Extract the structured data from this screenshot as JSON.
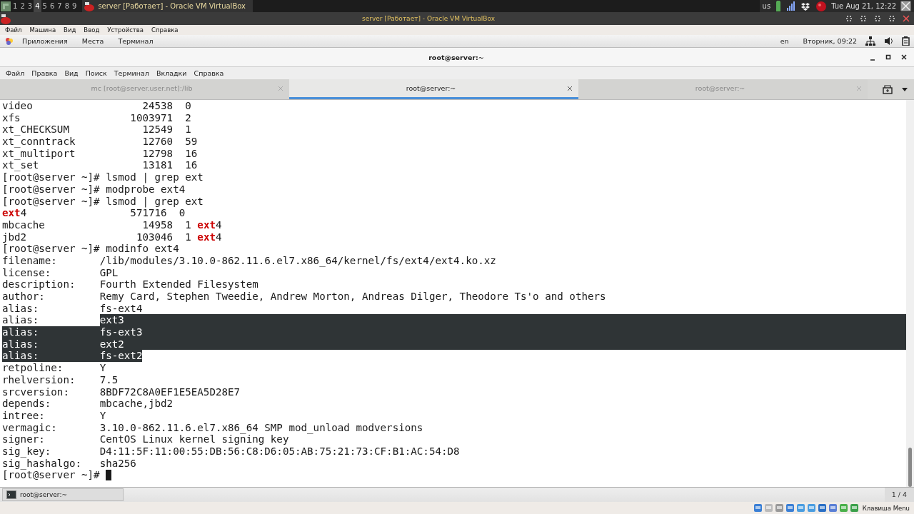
{
  "top_bar": {
    "workspaces": [
      {
        "label": "1",
        "selected": false
      },
      {
        "label": "2",
        "selected": false
      },
      {
        "label": "3",
        "selected": false
      },
      {
        "label": "4",
        "selected": true
      },
      {
        "label": "5",
        "selected": false
      },
      {
        "label": "6",
        "selected": false
      },
      {
        "label": "7",
        "selected": false
      },
      {
        "label": "8",
        "selected": false
      },
      {
        "label": "9",
        "selected": false
      }
    ],
    "task": "server [Работает] - Oracle VM VirtualBox",
    "layout": "us",
    "clock": "Tue Aug 21, 12:22"
  },
  "vm_window": {
    "title": "server [Работает] - Oracle VM VirtualBox",
    "menu": [
      "Файл",
      "Машина",
      "Вид",
      "Ввод",
      "Устройства",
      "Справка"
    ]
  },
  "gnome_panel": {
    "items": [
      "Приложения",
      "Места",
      "Терминал"
    ],
    "language": "en",
    "clock": "Вторник, 09:22"
  },
  "terminal": {
    "title": "root@server:~",
    "menu": [
      "Файл",
      "Правка",
      "Вид",
      "Поиск",
      "Терминал",
      "Вкладки",
      "Справка"
    ],
    "tabs": [
      {
        "label": "mc [root@server.user.net]:/lib",
        "selected": false
      },
      {
        "label": "root@server:~",
        "selected": true
      },
      {
        "label": "root@server:~",
        "selected": false
      }
    ],
    "lines": [
      {
        "segments": [
          {
            "kind": "text",
            "text": "video                  24538  0"
          }
        ]
      },
      {
        "segments": [
          {
            "kind": "text",
            "text": "xfs                  1003971  2"
          }
        ]
      },
      {
        "segments": [
          {
            "kind": "text",
            "text": "xt_CHECKSUM            12549  1"
          }
        ]
      },
      {
        "segments": [
          {
            "kind": "text",
            "text": "xt_conntrack           12760  59"
          }
        ]
      },
      {
        "segments": [
          {
            "kind": "text",
            "text": "xt_multiport           12798  16"
          }
        ]
      },
      {
        "segments": [
          {
            "kind": "text",
            "text": "xt_set                 13181  16"
          }
        ]
      },
      {
        "segments": [
          {
            "kind": "text",
            "text": "[root@server ~]# lsmod | grep ext"
          }
        ]
      },
      {
        "segments": [
          {
            "kind": "text",
            "text": "[root@server ~]# modprobe ext4"
          }
        ]
      },
      {
        "segments": [
          {
            "kind": "text",
            "text": "[root@server ~]# lsmod | grep ext"
          }
        ]
      },
      {
        "segments": [
          {
            "kind": "match",
            "text": "ext"
          },
          {
            "kind": "text",
            "text": "4                 571716  0"
          }
        ]
      },
      {
        "segments": [
          {
            "kind": "text",
            "text": "mbcache                14958  1 "
          },
          {
            "kind": "match",
            "text": "ext"
          },
          {
            "kind": "text",
            "text": "4"
          }
        ]
      },
      {
        "segments": [
          {
            "kind": "text",
            "text": "jbd2                  103046  1 "
          },
          {
            "kind": "match",
            "text": "ext"
          },
          {
            "kind": "text",
            "text": "4"
          }
        ]
      },
      {
        "segments": [
          {
            "kind": "text",
            "text": "[root@server ~]# modinfo ext4"
          }
        ]
      },
      {
        "segments": [
          {
            "kind": "text",
            "text": "filename:       /lib/modules/3.10.0-862.11.6.el7.x86_64/kernel/fs/ext4/ext4.ko.xz"
          }
        ]
      },
      {
        "segments": [
          {
            "kind": "text",
            "text": "license:        GPL"
          }
        ]
      },
      {
        "segments": [
          {
            "kind": "text",
            "text": "description:    Fourth Extended Filesystem"
          }
        ]
      },
      {
        "segments": [
          {
            "kind": "text",
            "text": "author:         Remy Card, Stephen Tweedie, Andrew Morton, Andreas Dilger, Theodore Ts'o and others"
          }
        ]
      },
      {
        "segments": [
          {
            "kind": "text",
            "text": "alias:          fs-ext4"
          }
        ]
      },
      {
        "segments": [
          {
            "kind": "text",
            "text": "alias:          "
          },
          {
            "kind": "selection",
            "text": "ext3"
          }
        ],
        "selected_to_end": true
      },
      {
        "segments": [
          {
            "kind": "selection",
            "text": "alias:          fs-ext3"
          }
        ],
        "selected_to_end": true
      },
      {
        "segments": [
          {
            "kind": "selection",
            "text": "alias:          ext2"
          }
        ],
        "selected_to_end": true
      },
      {
        "segments": [
          {
            "kind": "selection",
            "text": "alias:          fs-ext2"
          }
        ],
        "selected_to_end": false
      },
      {
        "segments": [
          {
            "kind": "text",
            "text": "retpoline:      Y"
          }
        ]
      },
      {
        "segments": [
          {
            "kind": "text",
            "text": "rhelversion:    7.5"
          }
        ]
      },
      {
        "segments": [
          {
            "kind": "text",
            "text": "srcversion:     8BDF72C8A0EF1E5EA5D28E7"
          }
        ]
      },
      {
        "segments": [
          {
            "kind": "text",
            "text": "depends:        mbcache,jbd2"
          }
        ]
      },
      {
        "segments": [
          {
            "kind": "text",
            "text": "intree:         Y"
          }
        ]
      },
      {
        "segments": [
          {
            "kind": "text",
            "text": "vermagic:       3.10.0-862.11.6.el7.x86_64 SMP mod_unload modversions"
          }
        ]
      },
      {
        "segments": [
          {
            "kind": "text",
            "text": "signer:         CentOS Linux kernel signing key"
          }
        ]
      },
      {
        "segments": [
          {
            "kind": "text",
            "text": "sig_key:        D4:11:5F:11:00:55:DB:56:C8:D6:05:AB:75:21:73:CF:B1:AC:54:D8"
          }
        ]
      },
      {
        "segments": [
          {
            "kind": "text",
            "text": "sig_hashalgo:   sha256"
          }
        ]
      },
      {
        "segments": [
          {
            "kind": "text",
            "text": "[root@server ~]# "
          },
          {
            "kind": "cursor"
          }
        ]
      }
    ]
  },
  "taskbar": {
    "items": [
      {
        "label": "root@server:~",
        "selected": true
      }
    ],
    "pager": "1 / 4"
  },
  "vm_status": {
    "host_key": "Клавиша Menu"
  }
}
